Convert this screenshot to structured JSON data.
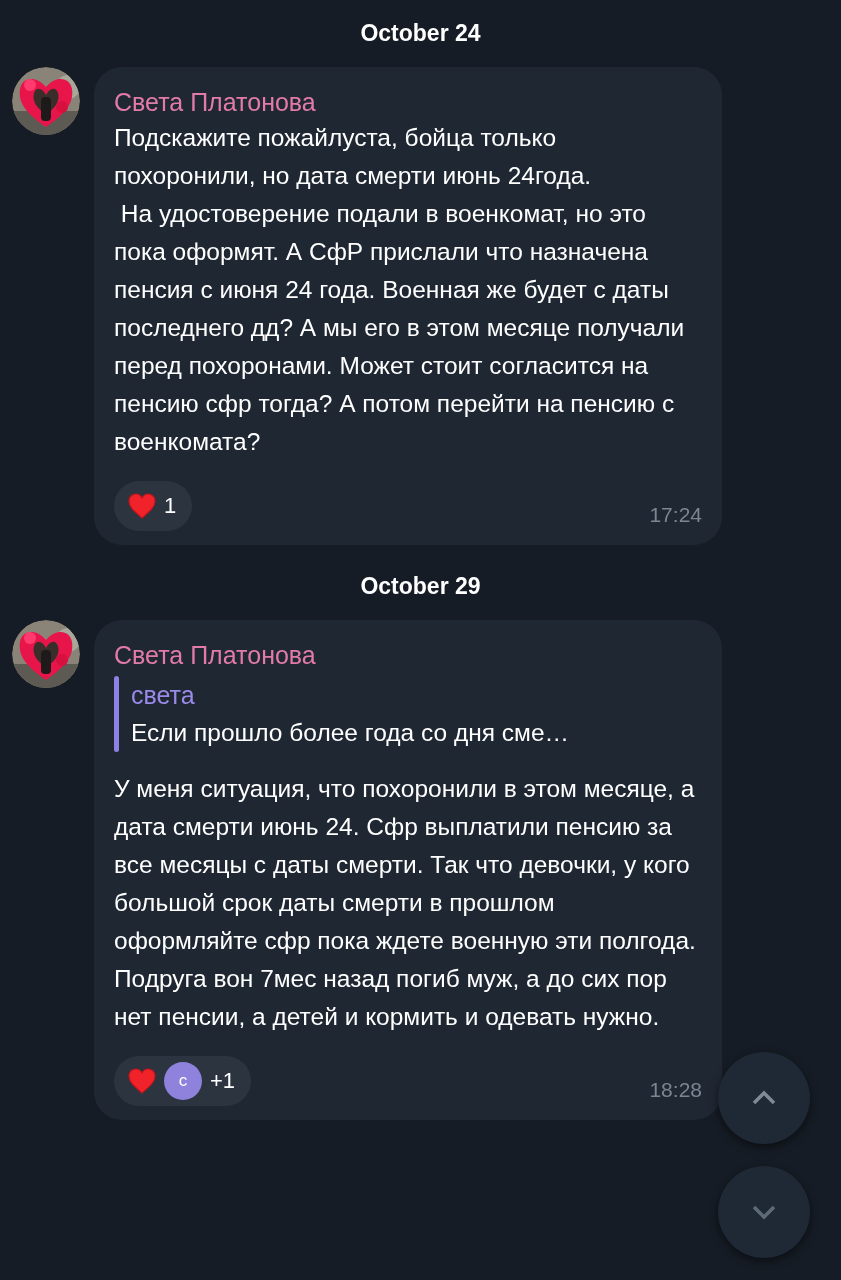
{
  "messages": [
    {
      "date": "October 24",
      "sender": "Света Платонова",
      "text": "Подскажите пожайлуста, бойца только похоронили, но дата смерти июнь 24года.\n На удостоверение подали в военкомат, но это пока оформят. А СфР прислали что назначена пенсия с июня 24 года. Военная же будет с даты последнего дд? А мы его в этом месяце получали перед похоронами. Может стоит согласится на пенсию сфр тогда? А потом перейти на пенсию с военкомата?",
      "reactions": [
        {
          "kind": "heart",
          "count": "1"
        }
      ],
      "time": "17:24"
    },
    {
      "date": "October 29",
      "sender": "Света Платонова",
      "reply": {
        "author": "света",
        "text": "Если прошло более года со дня сме…"
      },
      "text": "У меня ситуация, что похоронили в этом месяце, а дата смерти июнь 24. Сфр выплатили пенсию за все месяцы с даты смерти. Так что девочки, у кого большой срок даты смерти в прошлом оформляйте сфр пока ждете военную эти полгода. Подруга вон 7мес назад погиб муж, а до сих пор нет пенсии, а детей и кормить и одевать нужно.",
      "reactions": [
        {
          "kind": "heart"
        },
        {
          "kind": "avatar",
          "letter": "с",
          "color": "#8e82dc",
          "count": "+1"
        }
      ],
      "time": "18:28"
    }
  ]
}
